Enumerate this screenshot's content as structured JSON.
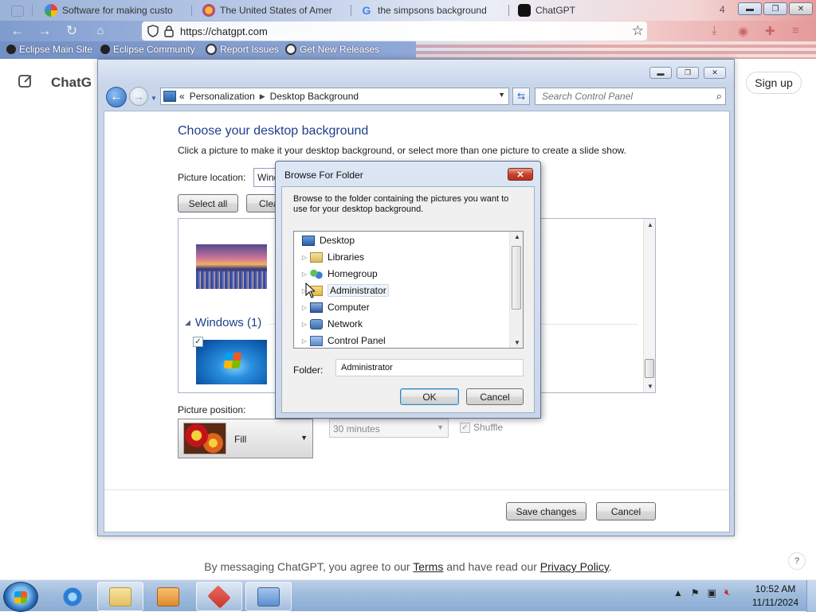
{
  "browser": {
    "tabs": [
      {
        "title": "Software for making custo",
        "icon_color": "#3f9a46"
      },
      {
        "title": "The United States of Amer",
        "icon_color": "#e66000"
      },
      {
        "title": "the simpsons background",
        "icon_color": "#4285f4"
      },
      {
        "title": "ChatGPT",
        "icon_color": "#111111"
      }
    ],
    "tab_count": "4",
    "url": "https://chatgpt.com",
    "bookmarks": [
      {
        "label": "Eclipse Main Site"
      },
      {
        "label": "Eclipse Community"
      },
      {
        "label": "Report Issues"
      },
      {
        "label": "Get New Releases"
      }
    ]
  },
  "chatgpt": {
    "title": "ChatG",
    "signup_label": "Sign up",
    "footer_prefix": "By messaging ChatGPT, you agree to our ",
    "terms_label": "Terms",
    "footer_middle": " and have read our ",
    "privacy_label": "Privacy Policy",
    "footer_suffix": ".",
    "help_label": "?"
  },
  "control_panel": {
    "breadcrumb": [
      "Personalization",
      "Desktop Background"
    ],
    "breadcrumb_prefix": "«",
    "search_placeholder": "Search Control Panel",
    "heading": "Choose your desktop background",
    "description": "Click a picture to make it your desktop background, or select more than one picture to create a slide show.",
    "picture_location_label": "Picture location:",
    "picture_location_value": "Wind",
    "select_all_label": "Select all",
    "clear_all_label": "Clea",
    "group_header": "Windows (1)",
    "picture_position_label": "Picture position:",
    "picture_position_value": "Fill",
    "interval_value": "30 minutes",
    "shuffle_label": "Shuffle",
    "save_label": "Save changes",
    "cancel_label": "Cancel"
  },
  "browse_dialog": {
    "title": "Browse For Folder",
    "description": "Browse to the folder containing the pictures you want to use for your desktop background.",
    "tree": [
      {
        "label": "Desktop",
        "expandable": false,
        "selected": false,
        "icon_color": "#3a6fb8"
      },
      {
        "label": "Libraries",
        "expandable": true,
        "selected": false,
        "icon_color": "#d9b85a"
      },
      {
        "label": "Homegroup",
        "expandable": true,
        "selected": false,
        "icon_color": "#3a9b5a"
      },
      {
        "label": "Administrator",
        "expandable": true,
        "selected": true,
        "icon_color": "#e0b84a"
      },
      {
        "label": "Computer",
        "expandable": true,
        "selected": false,
        "icon_color": "#4a78b8"
      },
      {
        "label": "Network",
        "expandable": true,
        "selected": false,
        "icon_color": "#3f6fa8"
      },
      {
        "label": "Control Panel",
        "expandable": true,
        "selected": false,
        "icon_color": "#5a88c8"
      }
    ],
    "folder_label": "Folder:",
    "folder_value": "Administrator",
    "ok_label": "OK",
    "cancel_label": "Cancel"
  },
  "taskbar": {
    "items": [
      {
        "name": "internet-explorer",
        "color": "#2a7fd4"
      },
      {
        "name": "file-explorer",
        "color": "#e4c062"
      },
      {
        "name": "media-player",
        "color": "#e08a2a"
      },
      {
        "name": "app-red",
        "color": "#c9342b"
      },
      {
        "name": "control-panel",
        "color": "#5b8fd0"
      }
    ],
    "time": "10:52 AM",
    "date": "11/11/2024"
  }
}
